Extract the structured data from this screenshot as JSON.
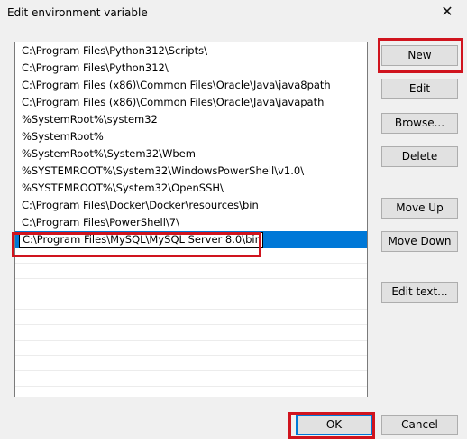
{
  "dialog": {
    "title": "Edit environment variable",
    "close_icon": "✕"
  },
  "paths": [
    "C:\\Program Files\\Python312\\Scripts\\",
    "C:\\Program Files\\Python312\\",
    "C:\\Program Files (x86)\\Common Files\\Oracle\\Java\\java8path",
    "C:\\Program Files (x86)\\Common Files\\Oracle\\Java\\javapath",
    "%SystemRoot%\\system32",
    "%SystemRoot%",
    "%SystemRoot%\\System32\\Wbem",
    "%SYSTEMROOT%\\System32\\WindowsPowerShell\\v1.0\\",
    "%SYSTEMROOT%\\System32\\OpenSSH\\",
    "C:\\Program Files\\Docker\\Docker\\resources\\bin",
    "C:\\Program Files\\PowerShell\\7\\"
  ],
  "editing_value": "C:\\Program Files\\MySQL\\MySQL Server 8.0\\bin",
  "buttons": {
    "new": "New",
    "edit": "Edit",
    "browse": "Browse...",
    "delete": "Delete",
    "move_up": "Move Up",
    "move_down": "Move Down",
    "edit_text": "Edit text...",
    "ok": "OK",
    "cancel": "Cancel"
  },
  "colors": {
    "selection": "#0078d7",
    "highlight_box": "#d0141e"
  }
}
